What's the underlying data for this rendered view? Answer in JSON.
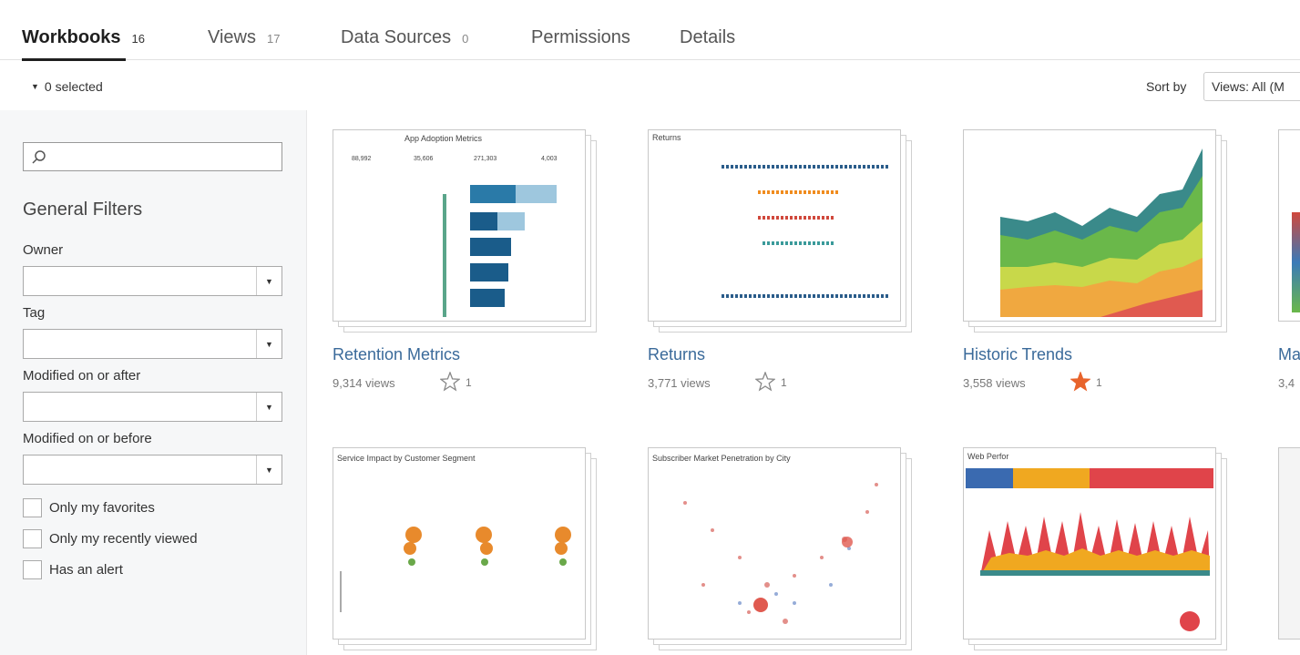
{
  "tabs": [
    {
      "label": "Workbooks",
      "count": "16"
    },
    {
      "label": "Views",
      "count": "17"
    },
    {
      "label": "Data Sources",
      "count": "0"
    },
    {
      "label": "Permissions",
      "count": ""
    },
    {
      "label": "Details",
      "count": ""
    }
  ],
  "selection": {
    "text": "0 selected"
  },
  "sort": {
    "label": "Sort by",
    "value": "Views: All (M"
  },
  "filters": {
    "search_placeholder": "",
    "heading": "General Filters",
    "owner_label": "Owner",
    "tag_label": "Tag",
    "modified_after_label": "Modified on or after",
    "modified_before_label": "Modified on or before",
    "checkboxes": [
      "Only my favorites",
      "Only my recently viewed",
      "Has an alert"
    ]
  },
  "workbooks": [
    {
      "name": "Retention Metrics",
      "views": "9,314 views",
      "favorites": "1",
      "favorited": false,
      "thumb_title": "App Adoption Metrics",
      "kpis": [
        "88,992",
        "35,606",
        "271,303",
        "4,003"
      ]
    },
    {
      "name": "Returns",
      "views": "3,771 views",
      "favorites": "1",
      "favorited": false,
      "thumb_title": "Returns"
    },
    {
      "name": "Historic Trends",
      "views": "3,558 views",
      "favorites": "1",
      "favorited": true
    },
    {
      "name": "Ma",
      "views": "3,4"
    },
    {
      "thumb_title": "Service Impact by Customer Segment"
    },
    {
      "thumb_title": "Subscriber Market Penetration by City"
    },
    {
      "thumb_title": "Web Perfor"
    }
  ],
  "colors": {
    "link": "#3a6a9a",
    "star_active": "#e8642c",
    "star_inactive": "#888888"
  },
  "icons": {
    "search": "search-icon",
    "star": "star-icon",
    "dropdown": "chevron-down-icon",
    "caret": "caret-down-icon"
  }
}
